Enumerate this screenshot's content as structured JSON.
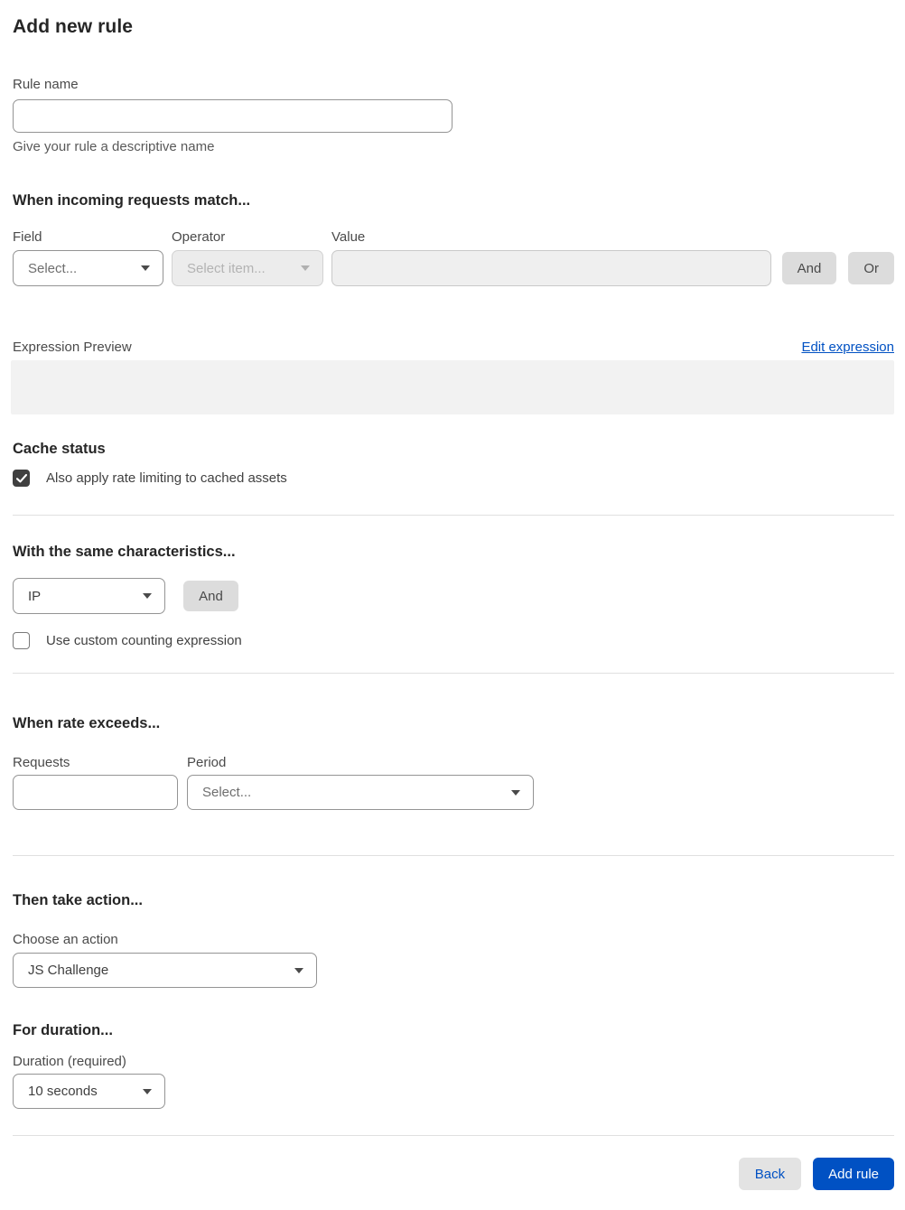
{
  "page": {
    "title": "Add new rule"
  },
  "rule_name": {
    "label": "Rule name",
    "value": "",
    "helper": "Give your rule a descriptive name"
  },
  "match": {
    "heading": "When incoming requests match...",
    "field": {
      "label": "Field",
      "placeholder": "Select..."
    },
    "operator": {
      "label": "Operator",
      "placeholder": "Select item...",
      "disabled": true
    },
    "value": {
      "label": "Value",
      "value": "",
      "disabled": true
    },
    "and_button": "And",
    "or_button": "Or"
  },
  "expression": {
    "label": "Expression Preview",
    "edit_link": "Edit expression",
    "preview": ""
  },
  "cache": {
    "heading": "Cache status",
    "checkbox_label": "Also apply rate limiting to cached assets",
    "checked": true
  },
  "characteristics": {
    "heading": "With the same characteristics...",
    "selected": "IP",
    "and_button": "And",
    "counting_checkbox_label": "Use custom counting expression",
    "counting_checked": false
  },
  "rate": {
    "heading": "When rate exceeds...",
    "requests": {
      "label": "Requests",
      "value": ""
    },
    "period": {
      "label": "Period",
      "placeholder": "Select..."
    }
  },
  "action": {
    "heading": "Then take action...",
    "label": "Choose an action",
    "selected": "JS Challenge"
  },
  "duration": {
    "heading": "For duration...",
    "label": "Duration (required)",
    "selected": "10 seconds"
  },
  "footer": {
    "back_button": "Back",
    "add_button": "Add rule"
  },
  "icons": {
    "chevron_down": "▾",
    "check": "✓"
  },
  "colors": {
    "accent_blue": "#0051c3",
    "heading_text": "#262626",
    "body_text": "#4a4a4a",
    "checkbox_checked": "#404040",
    "gray_button_bg": "#dcdcdc",
    "disabled_bg": "#ececec",
    "preview_box_bg": "#f2f2f2",
    "divider": "#e0e0e0"
  }
}
